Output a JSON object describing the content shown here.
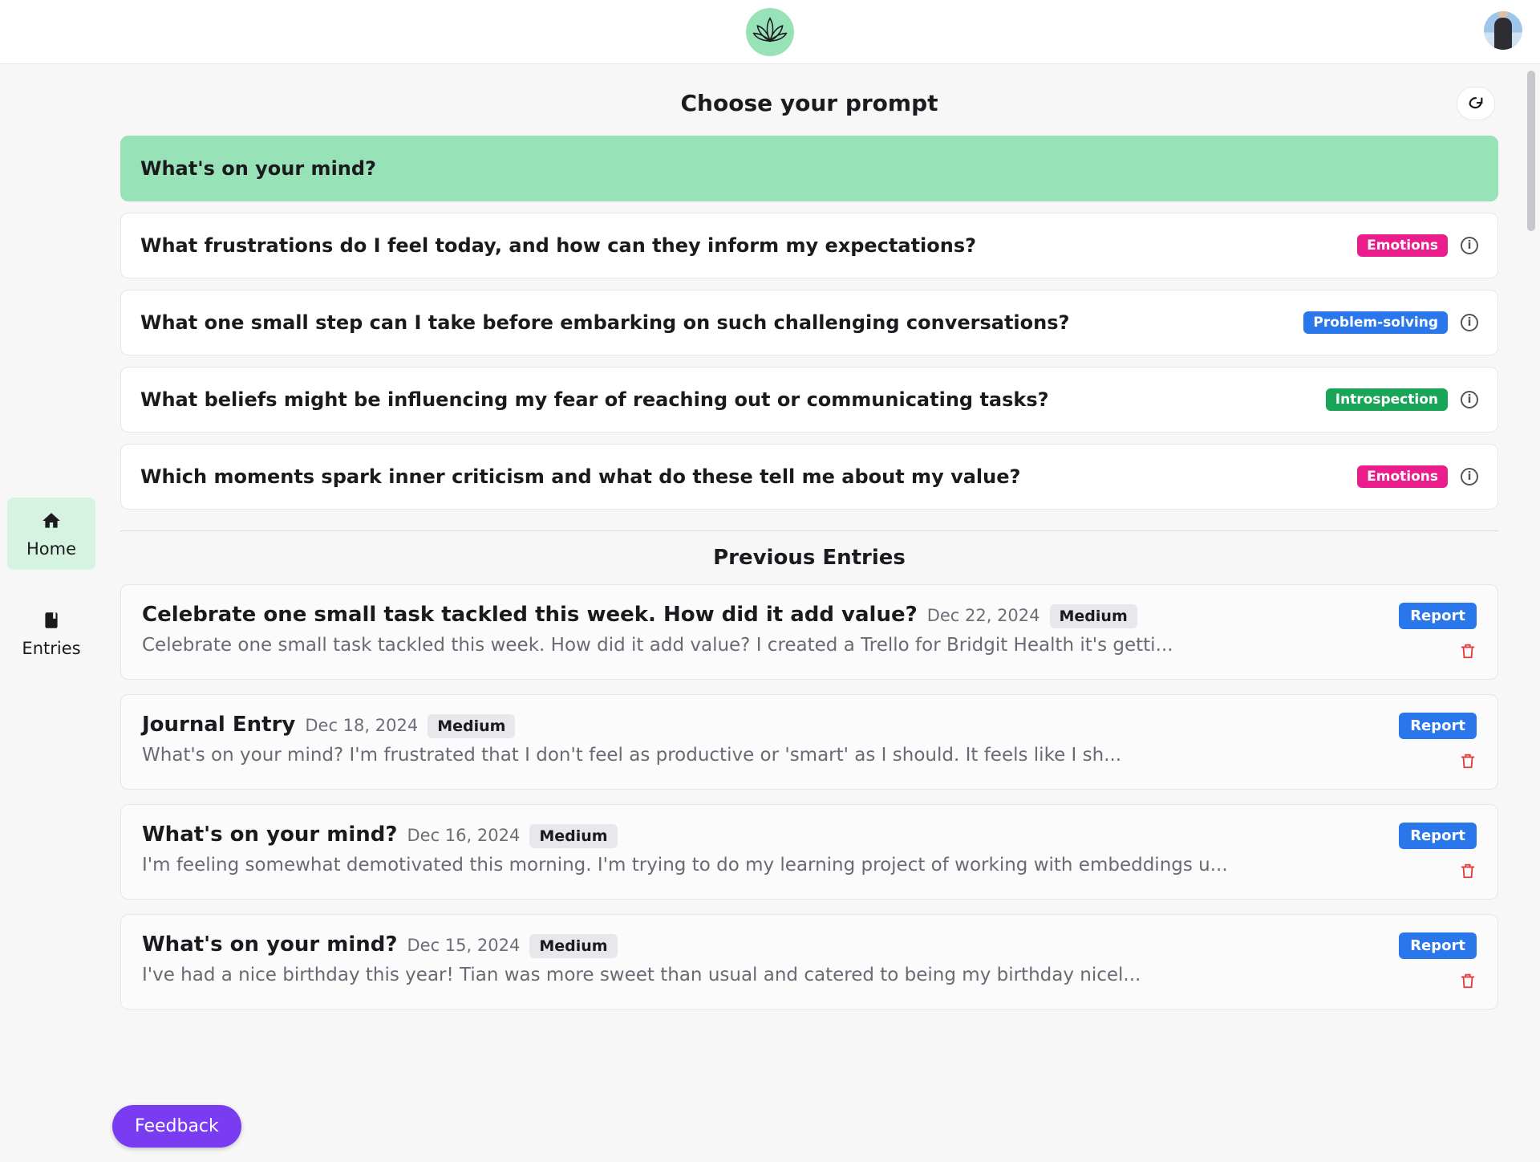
{
  "header": {},
  "sidebar": {
    "items": [
      {
        "label": "Home"
      },
      {
        "label": "Entries"
      }
    ]
  },
  "prompts": {
    "title": "Choose your prompt",
    "items": [
      {
        "text": "What's on your mind?",
        "selected": true
      },
      {
        "text": "What frustrations do I feel today, and how can they inform my expectations?",
        "tag": "Emotions",
        "tagClass": "emotions"
      },
      {
        "text": "What one small step can I take before embarking on such challenging conversations?",
        "tag": "Problem-solving",
        "tagClass": "problem-solving"
      },
      {
        "text": "What beliefs might be influencing my fear of reaching out or communicating tasks?",
        "tag": "Introspection",
        "tagClass": "introspection"
      },
      {
        "text": "Which moments spark inner criticism and what do these tell me about my value?",
        "tag": "Emotions",
        "tagClass": "emotions"
      }
    ]
  },
  "entries": {
    "title": "Previous Entries",
    "reportLabel": "Report",
    "items": [
      {
        "title": "Celebrate one small task tackled this week. How did it add value?",
        "date": "Dec 22, 2024",
        "length": "Medium",
        "preview": "Celebrate one small task tackled this week. How did it add value? I created a Trello for Bridgit Health it's getti..."
      },
      {
        "title": "Journal Entry",
        "date": "Dec 18, 2024",
        "length": "Medium",
        "preview": "What's on your mind? I'm frustrated that I don't feel as productive or 'smart' as I should. It feels like I sh..."
      },
      {
        "title": "What's on your mind?",
        "date": "Dec 16, 2024",
        "length": "Medium",
        "preview": "I'm feeling somewhat demotivated this morning. I'm trying to do my learning project of working with embeddings u..."
      },
      {
        "title": "What's on your mind?",
        "date": "Dec 15, 2024",
        "length": "Medium",
        "preview": "I've had a nice birthday this year! Tian was more sweet than usual and catered to being my birthday nicel..."
      }
    ]
  },
  "feedback": {
    "label": "Feedback"
  }
}
